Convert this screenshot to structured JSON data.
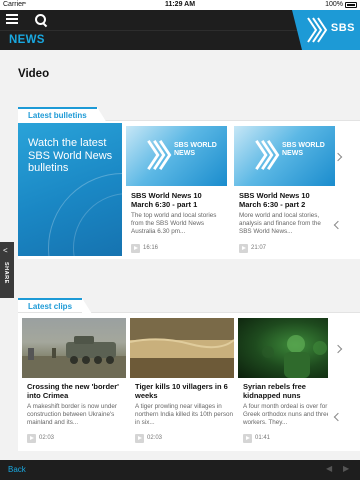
{
  "status_bar": {
    "carrier": "Carrier",
    "wifi": "≈",
    "time": "11:29 AM",
    "battery": "100%"
  },
  "header": {
    "section": "NEWS",
    "logo_text": "SBS"
  },
  "page": {
    "title": "Video"
  },
  "bulletins": {
    "tab_label": "Latest bulletins",
    "promo_text": "Watch the latest SBS World News bulletins",
    "items": [
      {
        "thumb_text": "SBS WORLD NEWS",
        "title": "SBS World News 10 March 6:30 - part 1",
        "description": "The top world and local stories from the SBS World News Australia 6.30 pm...",
        "duration": "16:16"
      },
      {
        "thumb_text": "SBS WORLD NEWS",
        "title": "SBS World News 10 March 6:30 - part 2",
        "description": "More world and local stories, analysis and finance from the SBS World News...",
        "duration": "21:07"
      }
    ]
  },
  "clips": {
    "tab_label": "Latest clips",
    "items": [
      {
        "title": "Crossing the new 'border' into Crimea",
        "description": "A makeshift border is now under construction between Ukraine's mainland and its...",
        "duration": "02:03"
      },
      {
        "title": "Tiger kills 10 villagers in 6 weeks",
        "description": "A tiger prowling near villages in northern India killed its 10th person in six...",
        "duration": "02:03"
      },
      {
        "title": "Syrian rebels free kidnapped nuns",
        "description": "A four month ordeal is over for 13 Greek orthodox nuns and three workers. They...",
        "duration": "01:41"
      }
    ]
  },
  "share": {
    "label": "SHARE",
    "icon": "<"
  },
  "footer": {
    "back_label": "Back",
    "prev_arrow": "◀",
    "next_arrow": "▶"
  },
  "colors": {
    "accent": "#1d9ad6",
    "bar": "#1e1e1e",
    "background": "#f2f2f2"
  }
}
